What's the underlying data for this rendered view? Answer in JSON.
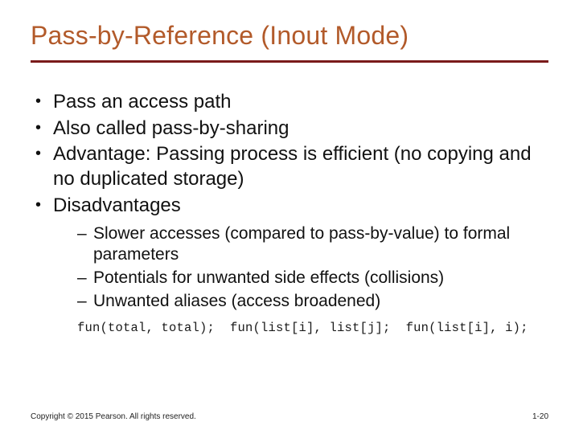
{
  "title": "Pass-by-Reference (Inout Mode)",
  "bullets": {
    "b0": "Pass an access path",
    "b1": "Also called pass-by-sharing",
    "b2": "Advantage: Passing process is efficient (no copying and no duplicated storage)",
    "b3": "Disadvantages"
  },
  "sub": {
    "s0": "Slower accesses (compared to pass-by-value) to formal parameters",
    "s1": "Potentials for unwanted side effects (collisions)",
    "s2": "Unwanted aliases (access broadened)"
  },
  "code": "fun(total, total);  fun(list[i], list[j];  fun(list[i], i);",
  "footer": {
    "copyright": "Copyright © 2015 Pearson. All rights reserved.",
    "pagenum": "1-20"
  }
}
